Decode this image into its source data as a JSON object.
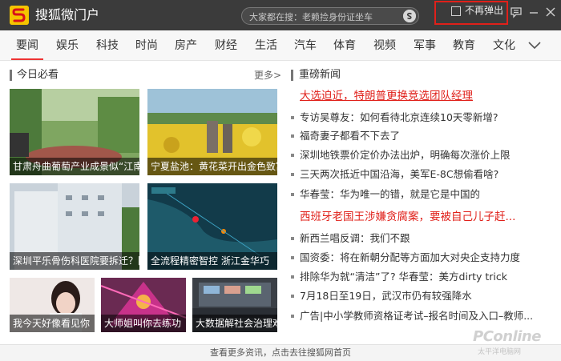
{
  "titlebar": {
    "app_title": "搜狐微门户",
    "search_placeholder": "大家都在搜：老赖捡身份证坐车",
    "popup_checkbox_label": "不再弹出"
  },
  "nav": {
    "items": [
      "要闻",
      "娱乐",
      "科技",
      "时尚",
      "房产",
      "财经",
      "生活",
      "汽车",
      "体育",
      "视频",
      "军事",
      "教育",
      "文化"
    ],
    "active_index": 0
  },
  "left": {
    "section_title": "今日必看",
    "more_label": "更多>",
    "tiles": [
      {
        "caption": "甘肃舟曲葡萄产业成景似“江南"
      },
      {
        "caption": "宁夏盐池：黄花菜开出金色致富"
      },
      {
        "caption": "深圳平乐骨伤科医院要拆迁？院"
      },
      {
        "caption": "全流程精密智控 浙江金华巧"
      },
      {
        "caption": "我今天好像看见你"
      },
      {
        "caption": "大师姐叫你去练功"
      },
      {
        "caption": "大数据解社会治理难"
      }
    ]
  },
  "right": {
    "section_title": "重磅新闻",
    "headline_1": "大选迫近，特朗普更换竞选团队经理",
    "group_1": [
      "专访吴尊友：如何看待北京连续10天零新增?",
      "福奇妻子都看不下去了",
      "深圳地铁票价定价办法出炉，明确每次涨价上限",
      "三天两次抵近中国沿海，美军E-8C想偷看啥?",
      "华春莹：华为唯一的错，就是它是中国的"
    ],
    "headline_2": "西班牙老国王涉嫌贪腐案，要被自己儿子赶...",
    "group_2": [
      "新西兰唱反调：我们不跟",
      "国资委：将在新朝分配等方面加大对央企支持力度",
      "排除华为就“清洁”了? 华春莹：美方dirty trick",
      "7月18日至19日，武汉市仍有较强降水",
      "广告|中小学教师资格证考试–报名时间及入口–教师..."
    ]
  },
  "footer": {
    "text": "查看更多资讯，点击去往搜狐网首页"
  },
  "watermark": {
    "brand": "PConline",
    "sub": "太平洋电脑网"
  },
  "colors": {
    "titlebar_bg": "#3b3b3b",
    "accent_red": "#e0201a",
    "logo_yellow": "#f5c400"
  }
}
